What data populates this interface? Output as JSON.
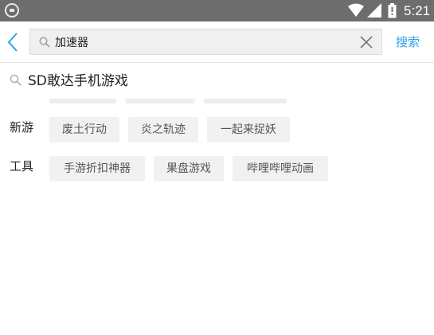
{
  "status_bar": {
    "time": "5:21"
  },
  "header": {
    "search_value": "加速器",
    "search_button_label": "搜索"
  },
  "suggestion": {
    "text": "SD敢达手机游戏"
  },
  "categories": [
    {
      "label": "新游",
      "tags": [
        "废土行动",
        "炎之轨迹",
        "一起来捉妖"
      ]
    },
    {
      "label": "工具",
      "tags": [
        "手游折扣神器",
        "果盘游戏",
        "哔哩哔哩动画"
      ]
    }
  ],
  "colors": {
    "accent": "#2aa1e8",
    "status_bar": "#6d6d6d",
    "tag_background": "#f1f1f1"
  }
}
